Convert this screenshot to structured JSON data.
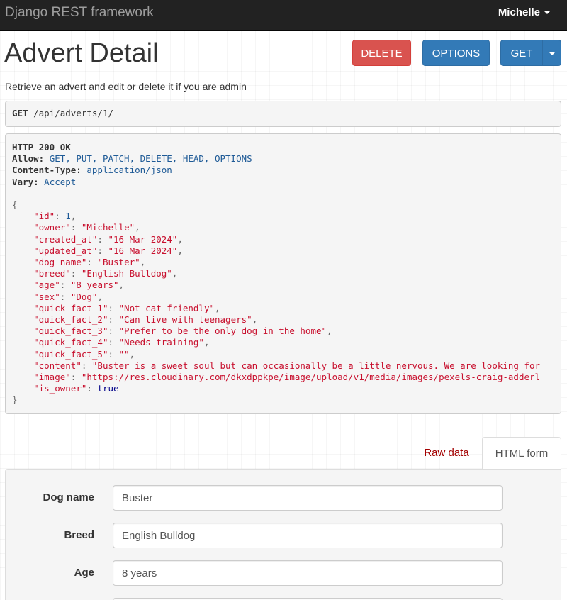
{
  "navbar": {
    "brand": "Django REST framework",
    "user": "Michelle"
  },
  "page": {
    "title": "Advert Detail",
    "description": "Retrieve an advert and edit or delete it if you are admin"
  },
  "buttons": {
    "delete": "DELETE",
    "options": "OPTIONS",
    "get": "GET"
  },
  "request": {
    "method": "GET",
    "url": "/api/adverts/1/"
  },
  "response": {
    "status": "HTTP 200 OK",
    "headers": [
      {
        "name": "Allow:",
        "value": "GET, PUT, PATCH, DELETE, HEAD, OPTIONS"
      },
      {
        "name": "Content-Type:",
        "value": "application/json"
      },
      {
        "name": "Vary:",
        "value": "Accept"
      }
    ],
    "open_brace": "{",
    "close_brace": "}",
    "fields": [
      {
        "key": "\"id\"",
        "value": "1",
        "kind": "num"
      },
      {
        "key": "\"owner\"",
        "value": "\"Michelle\"",
        "kind": "str"
      },
      {
        "key": "\"created_at\"",
        "value": "\"16 Mar 2024\"",
        "kind": "str"
      },
      {
        "key": "\"updated_at\"",
        "value": "\"16 Mar 2024\"",
        "kind": "str"
      },
      {
        "key": "\"dog_name\"",
        "value": "\"Buster\"",
        "kind": "str"
      },
      {
        "key": "\"breed\"",
        "value": "\"English Bulldog\"",
        "kind": "str"
      },
      {
        "key": "\"age\"",
        "value": "\"8 years\"",
        "kind": "str"
      },
      {
        "key": "\"sex\"",
        "value": "\"Dog\"",
        "kind": "str"
      },
      {
        "key": "\"quick_fact_1\"",
        "value": "\"Not cat friendly\"",
        "kind": "str"
      },
      {
        "key": "\"quick_fact_2\"",
        "value": "\"Can live with teenagers\"",
        "kind": "str"
      },
      {
        "key": "\"quick_fact_3\"",
        "value": "\"Prefer to be the only dog in the home\"",
        "kind": "str"
      },
      {
        "key": "\"quick_fact_4\"",
        "value": "\"Needs training\"",
        "kind": "str"
      },
      {
        "key": "\"quick_fact_5\"",
        "value": "\"\"",
        "kind": "str"
      },
      {
        "key": "\"content\"",
        "value": "\"Buster is a sweet soul but can occasionally be a little nervous. We are looking for",
        "kind": "str",
        "truncated": true
      },
      {
        "key": "\"image\"",
        "value": "\"https://res.cloudinary.com/dkxdppkpe/image/upload/v1/media/images/pexels-craig-adderl",
        "kind": "str",
        "truncated": true
      },
      {
        "key": "\"is_owner\"",
        "value": "true",
        "kind": "kw",
        "last": true
      }
    ]
  },
  "tabs": {
    "raw": "Raw data",
    "html": "HTML form"
  },
  "form": {
    "fields": [
      {
        "label": "Dog name",
        "value": "Buster"
      },
      {
        "label": "Breed",
        "value": "English Bulldog"
      },
      {
        "label": "Age",
        "value": "8 years"
      },
      {
        "label": "",
        "value": ""
      }
    ]
  }
}
